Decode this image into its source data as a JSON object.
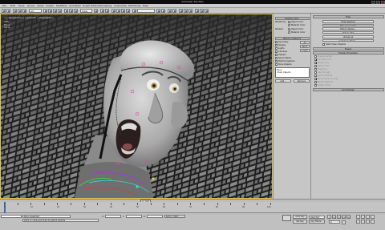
{
  "window": {
    "title": "Autodesk 3ds Max"
  },
  "menus": [
    "File",
    "Edit",
    "Tools",
    "Group",
    "Views",
    "Create",
    "Modifiers",
    "Animation",
    "Graph Editors",
    "Rendering",
    "Customize",
    "MAXScript",
    "Help"
  ],
  "toolbar": {
    "selection_filter": "All",
    "view_coordinate": "View",
    "named_selection": ""
  },
  "viewport": {
    "label": "+ [ Perspective ] [ Smooth + Highlights ]",
    "stats": [
      "Total",
      "Polys:",
      "Verts:"
    ],
    "border_color": "#e3c24a"
  },
  "display_panel": {
    "header_button": "Display Color",
    "rows": [
      {
        "label": "Wireframe:",
        "option": "Object Color",
        "selected": true
      },
      {
        "label": "",
        "option": "Material Color",
        "selected": false
      },
      {
        "label": "Shaded:",
        "option": "Object Color",
        "selected": true
      },
      {
        "label": "",
        "option": "Material Color",
        "selected": false
      }
    ],
    "hide_by_category_label": "Hide by Category",
    "categories": [
      "Geometry",
      "Shapes",
      "Lights",
      "Cameras",
      "Helpers",
      "Space Warps",
      "Particle Systems",
      "Bone Objects"
    ],
    "side_buttons": [
      "All",
      "None",
      "Invert"
    ],
    "list_items": [
      "Bone",
      "Chain Objects"
    ],
    "add_button": "Add...",
    "remove_button": "Remove"
  },
  "command_panel": {
    "hide_rollout": "Hide",
    "hide_buttons": [
      "Hide Selected",
      "Hide Unselected",
      "Hide by Name...",
      "Hide by Hit"
    ],
    "unhide_buttons": [
      "Unhide All",
      "Unhide by Name..."
    ],
    "hide_frozen_label": "Hide Frozen Objects",
    "freeze_rollout": "Freeze",
    "display_properties_rollout": "Display Properties",
    "display_properties": [
      {
        "label": "Display as Box",
        "checked": false
      },
      {
        "label": "Backface Cull",
        "checked": true
      },
      {
        "label": "Edges Only",
        "checked": true
      },
      {
        "label": "Vertex Ticks",
        "checked": false
      },
      {
        "label": "Trajectory",
        "checked": false
      },
      {
        "label": "See-Through",
        "checked": false
      },
      {
        "label": "Ignore Extents",
        "checked": false
      },
      {
        "label": "Show Frozen in Gray",
        "checked": true
      },
      {
        "label": "Never Degrade",
        "checked": false
      },
      {
        "label": "Vertex Colors",
        "checked": false
      }
    ],
    "link_display_rollout": "Link Display"
  },
  "timeline": {
    "slider_label": "0 / 100",
    "current_frame": 0,
    "frame_total": 100,
    "tick_labels": [
      "0",
      "10",
      "20",
      "30",
      "40",
      "50",
      "60",
      "70",
      "80",
      "90",
      "100"
    ]
  },
  "status": {
    "maxscript_field": "",
    "selection_info": "None Selected",
    "prompt": "Click or click-and-drag to select objects",
    "x_label": "X:",
    "y_label": "Y:",
    "z_label": "Z:",
    "grid_text": "Grid = 10.0",
    "auto_key": "Auto Key",
    "set_key": "Set Key",
    "selected_dropdown": "Selected",
    "key_filters": "Key Filters...",
    "frame_field": "0",
    "playback": [
      "|<",
      "<|",
      ">",
      "|>",
      ">|"
    ]
  }
}
